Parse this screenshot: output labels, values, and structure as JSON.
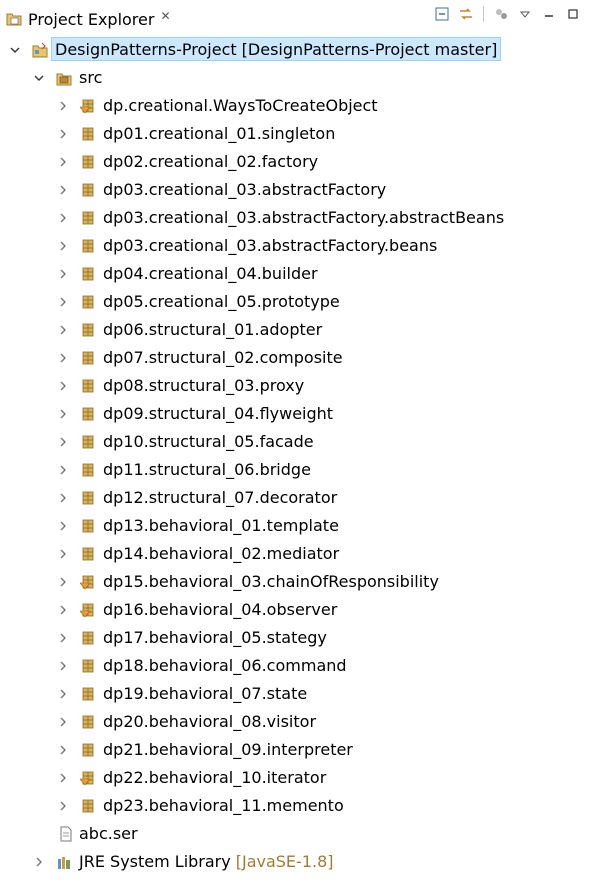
{
  "view": {
    "title": "Project Explorer",
    "close_glyph": "✕",
    "toolbar": [
      "collapse-all-icon",
      "link-with-editor-icon",
      "filter-icon",
      "view-menu-icon",
      "minimize-icon",
      "maximize-icon"
    ]
  },
  "tree": {
    "project": {
      "label": "DesignPatterns-Project",
      "decoration": "[DesignPatterns-Project master]"
    },
    "src": {
      "label": "src"
    },
    "packages": [
      {
        "label": "dp.creational.WaysToCreateObject",
        "flagged": true
      },
      {
        "label": "dp01.creational_01.singleton",
        "flagged": false
      },
      {
        "label": "dp02.creational_02.factory",
        "flagged": false
      },
      {
        "label": "dp03.creational_03.abstractFactory",
        "flagged": false
      },
      {
        "label": "dp03.creational_03.abstractFactory.abstractBeans",
        "flagged": false
      },
      {
        "label": "dp03.creational_03.abstractFactory.beans",
        "flagged": false
      },
      {
        "label": "dp04.creational_04.builder",
        "flagged": false
      },
      {
        "label": "dp05.creational_05.prototype",
        "flagged": false
      },
      {
        "label": "dp06.structural_01.adopter",
        "flagged": false
      },
      {
        "label": "dp07.structural_02.composite",
        "flagged": false
      },
      {
        "label": "dp08.structural_03.proxy",
        "flagged": false
      },
      {
        "label": "dp09.structural_04.flyweight",
        "flagged": false
      },
      {
        "label": "dp10.structural_05.facade",
        "flagged": false
      },
      {
        "label": "dp11.structural_06.bridge",
        "flagged": false
      },
      {
        "label": "dp12.structural_07.decorator",
        "flagged": false
      },
      {
        "label": "dp13.behavioral_01.template",
        "flagged": false
      },
      {
        "label": "dp14.behavioral_02.mediator",
        "flagged": false
      },
      {
        "label": "dp15.behavioral_03.chainOfResponsibility",
        "flagged": true
      },
      {
        "label": "dp16.behavioral_04.observer",
        "flagged": true
      },
      {
        "label": "dp17.behavioral_05.stategy",
        "flagged": false
      },
      {
        "label": "dp18.behavioral_06.command",
        "flagged": false
      },
      {
        "label": "dp19.behavioral_07.state",
        "flagged": false
      },
      {
        "label": "dp20.behavioral_08.visitor",
        "flagged": false
      },
      {
        "label": "dp21.behavioral_09.interpreter",
        "flagged": false
      },
      {
        "label": "dp22.behavioral_10.iterator",
        "flagged": true
      },
      {
        "label": "dp23.behavioral_11.memento",
        "flagged": false
      }
    ],
    "file": {
      "label": "abc.ser"
    },
    "library": {
      "label": "JRE System Library",
      "decoration": "[JavaSE-1.8]"
    }
  },
  "colors": {
    "selection": "#cce8ff",
    "selection_border": "#99d1ff",
    "decoration": "#a07c30",
    "package": "#b58a3a"
  }
}
